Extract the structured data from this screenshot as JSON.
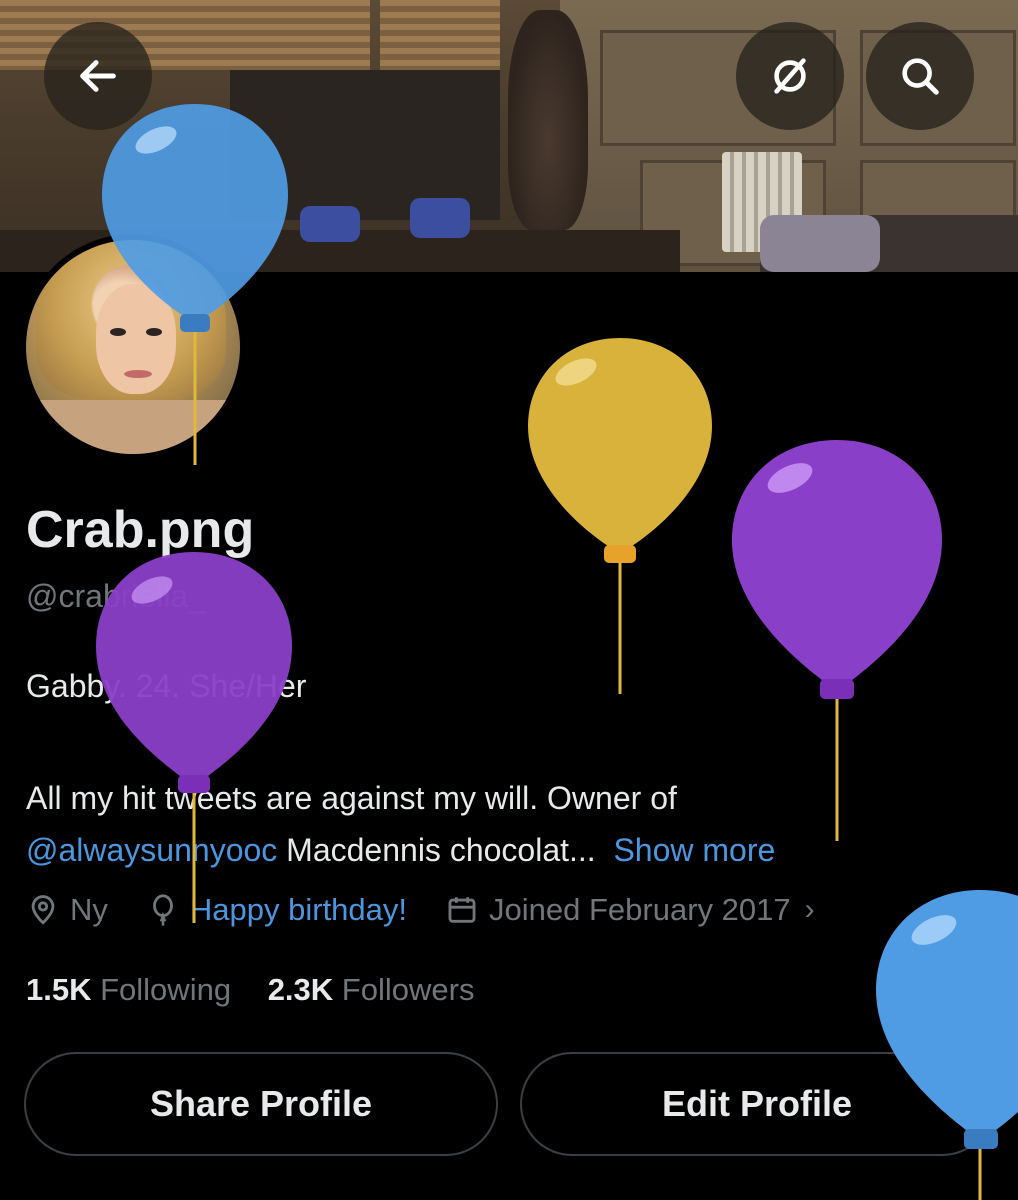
{
  "header": {
    "back_icon": "back-arrow-icon",
    "spaces_icon": "slashed-circle-icon",
    "search_icon": "search-icon"
  },
  "profile": {
    "name": "Crab.png",
    "handle": "@crabriella_",
    "bio_line1": "Gabby. 24. She/Her",
    "bio_line2_start": "All my hit tweets are against my will. Owner of",
    "bio_mention": "@alwaysunnyooc",
    "bio_line2_rest": " Macdennis chocolat...",
    "show_more": "Show more",
    "location": "Ny",
    "birthday": "Happy birthday!",
    "joined": "Joined February 2017"
  },
  "stats": {
    "following_count": "1.5K",
    "following_label": "Following",
    "followers_count": "2.3K",
    "followers_label": "Followers"
  },
  "actions": {
    "share_label": "Share Profile",
    "edit_label": "Edit Profile"
  },
  "colors": {
    "background": "#000000",
    "link": "#4a97e0",
    "muted": "#71767b",
    "balloon_blue": "#4f9ce4",
    "balloon_yellow": "#e0b83c",
    "balloon_purple": "#8a3fc8"
  }
}
